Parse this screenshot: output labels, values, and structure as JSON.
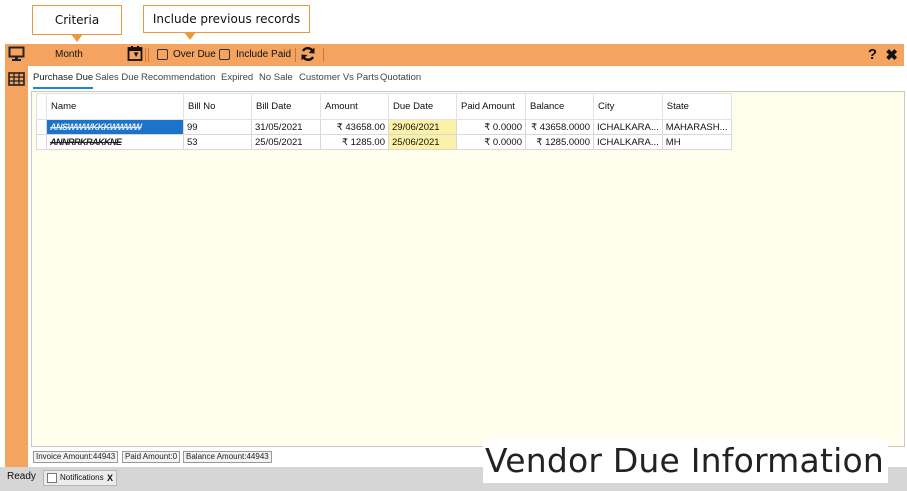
{
  "callouts": {
    "criteria": "Criteria",
    "include_previous": "Include previous records"
  },
  "toolbar": {
    "period_select": "Month",
    "over_due_label": "Over Due",
    "include_paid_label": "Include Paid",
    "help": "?",
    "close": "✖"
  },
  "tabs": [
    {
      "label": "Purchase Due",
      "active": true
    },
    {
      "label": "Sales Due"
    },
    {
      "label": "Recommendation"
    },
    {
      "label": "Expired"
    },
    {
      "label": "No Sale"
    },
    {
      "label": "Customer Vs Parts"
    },
    {
      "label": "Quotation"
    }
  ],
  "grid": {
    "columns": [
      "Name",
      "Bill No",
      "Bill Date",
      "Amount",
      "Due Date",
      "Paid Amount",
      "Balance",
      "City",
      "State"
    ],
    "rows": [
      {
        "name": "ANSWWWKKKWWWW",
        "bill_no": "99",
        "bill_date": "31/05/2021",
        "amount": "₹ 43658.00",
        "due_date": "29/06/2021",
        "paid": "₹ 0.0000",
        "balance": "₹ 43658.0000",
        "city": "ICHALKARA...",
        "state": "MAHARASH..."
      },
      {
        "name": "ANNRRKRAKKNE",
        "bill_no": "53",
        "bill_date": "25/05/2021",
        "amount": "₹ 1285.00",
        "due_date": "25/06/2021",
        "paid": "₹ 0.0000",
        "balance": "₹ 1285.0000",
        "city": "ICHALKARA...",
        "state": "MH"
      }
    ]
  },
  "totals": {
    "invoice": "Invoice Amount:44943",
    "paid": "Paid Amount:0",
    "balance": "Balance Amount:44943"
  },
  "status": {
    "text": "Ready",
    "notifications_tab": "Notifications",
    "notifications_close": "X"
  },
  "overlay_title": "Vendor Due Information",
  "colors": {
    "accent": "#f4a460",
    "panel_bg": "#fffdeb",
    "due_highlight": "#fbf2a8",
    "selection": "#1b74c9",
    "tab_underline": "#1e88c8"
  },
  "icons": {
    "monitor": "monitor-icon",
    "grid": "table-icon",
    "calendar": "calendar-icon",
    "refresh": "refresh-icon"
  }
}
